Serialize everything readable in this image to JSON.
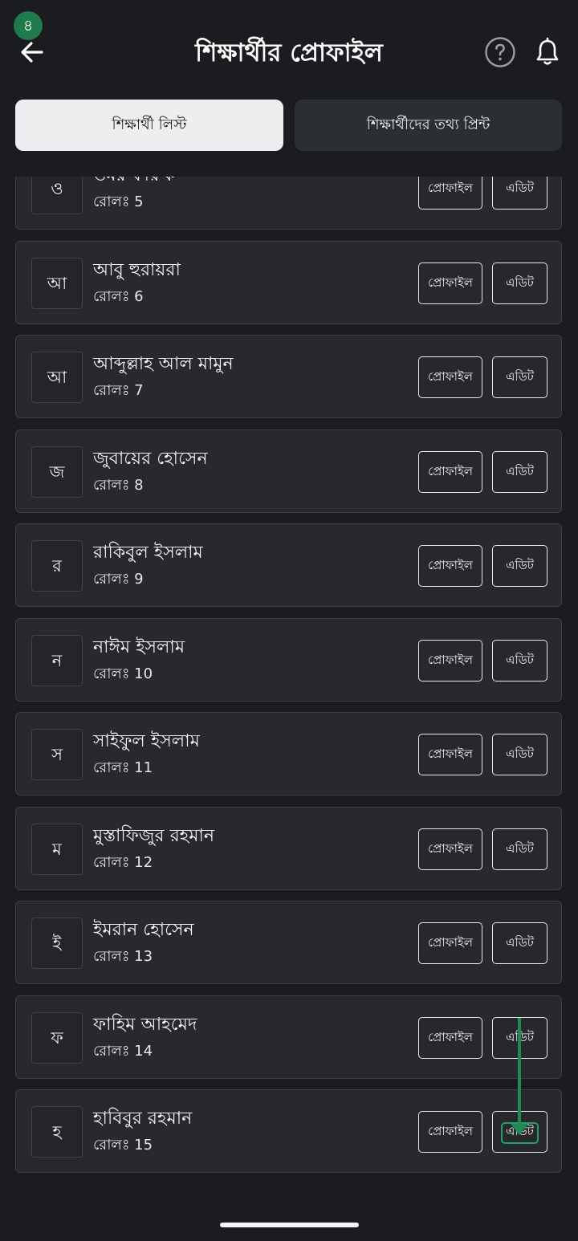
{
  "step_badge": "৪",
  "header": {
    "title": "শিক্ষার্থীর প্রোফাইল",
    "back_icon": "arrow-left-icon",
    "help_icon": "question-circle-icon",
    "bell_icon": "bell-icon"
  },
  "tabs": [
    {
      "label": "শিক্ষার্থী লিস্ট",
      "active": true
    },
    {
      "label": "শিক্ষার্থীদের তথ্য প্রিন্ট",
      "active": false
    }
  ],
  "students": [
    {
      "initial": "ও",
      "name": "ওমর ফারুক",
      "roll": "রোলঃ 5",
      "profile_label": "প্রোফাইল",
      "edit_label": "এডিট"
    },
    {
      "initial": "আ",
      "name": "আবু হুরায়রা",
      "roll": "রোলঃ 6",
      "profile_label": "প্রোফাইল",
      "edit_label": "এডিট"
    },
    {
      "initial": "আ",
      "name": "আব্দুল্লাহ আল মামুন",
      "roll": "রোলঃ 7",
      "profile_label": "প্রোফাইল",
      "edit_label": "এডিট"
    },
    {
      "initial": "জ",
      "name": "জুবায়ের হোসেন",
      "roll": "রোলঃ 8",
      "profile_label": "প্রোফাইল",
      "edit_label": "এডিট"
    },
    {
      "initial": "র",
      "name": "রাকিবুল ইসলাম",
      "roll": "রোলঃ 9",
      "profile_label": "প্রোফাইল",
      "edit_label": "এডিট"
    },
    {
      "initial": "ন",
      "name": "নাঈম ইসলাম",
      "roll": "রোলঃ 10",
      "profile_label": "প্রোফাইল",
      "edit_label": "এডিট"
    },
    {
      "initial": "স",
      "name": "সাইফুল ইসলাম",
      "roll": "রোলঃ 11",
      "profile_label": "প্রোফাইল",
      "edit_label": "এডিট"
    },
    {
      "initial": "ম",
      "name": "মুস্তাফিজুর রহমান",
      "roll": "রোলঃ 12",
      "profile_label": "প্রোফাইল",
      "edit_label": "এডিট"
    },
    {
      "initial": "ই",
      "name": "ইমরান হোসেন",
      "roll": "রোলঃ 13",
      "profile_label": "প্রোফাইল",
      "edit_label": "এডিট"
    },
    {
      "initial": "ফ",
      "name": "ফাহিম আহমেদ",
      "roll": "রোলঃ 14",
      "profile_label": "প্রোফাইল",
      "edit_label": "এডিট"
    },
    {
      "initial": "হ",
      "name": "হাবিবুর রহমান",
      "roll": "রোলঃ 15",
      "profile_label": "প্রোফাইল",
      "edit_label": "এডিট",
      "highlighted": true
    }
  ],
  "colors": {
    "background": "#1b1c1f",
    "card": "#27292e",
    "accent_green": "#1f8a52",
    "active_tab": "#eceeef"
  }
}
